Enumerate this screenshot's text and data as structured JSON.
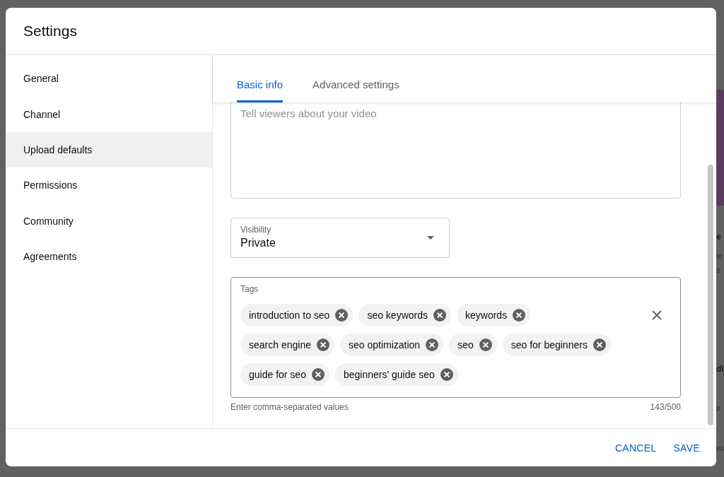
{
  "dialog": {
    "title": "Settings"
  },
  "sidebar": {
    "items": [
      {
        "label": "General",
        "selected": false
      },
      {
        "label": "Channel",
        "selected": false
      },
      {
        "label": "Upload defaults",
        "selected": true
      },
      {
        "label": "Permissions",
        "selected": false
      },
      {
        "label": "Community",
        "selected": false
      },
      {
        "label": "Agreements",
        "selected": false
      }
    ]
  },
  "tabs": [
    {
      "label": "Basic info",
      "selected": true
    },
    {
      "label": "Advanced settings",
      "selected": false
    }
  ],
  "description": {
    "placeholder": "Tell viewers about your video"
  },
  "visibility": {
    "label": "Visibility",
    "value": "Private"
  },
  "tags": {
    "label": "Tags",
    "items": [
      "introduction to seo",
      "seo keywords",
      "keywords",
      "search engine",
      "seo optimization",
      "seo",
      "seo for beginners",
      "guide for seo",
      "beginners' guide seo"
    ],
    "hint": "Enter comma-separated values",
    "counter": "143/500"
  },
  "buttons": [
    "CANCEL",
    "SAVE"
  ],
  "background": {
    "fragments": [
      {
        "text": "e",
        "kind": "heading"
      },
      {
        "text": "re",
        "kind": "body"
      },
      {
        "text": "o",
        "kind": "body"
      },
      {
        "text": "di",
        "kind": "heading"
      },
      {
        "text": "p",
        "kind": "body"
      },
      {
        "text": "es",
        "kind": "body"
      }
    ]
  }
}
